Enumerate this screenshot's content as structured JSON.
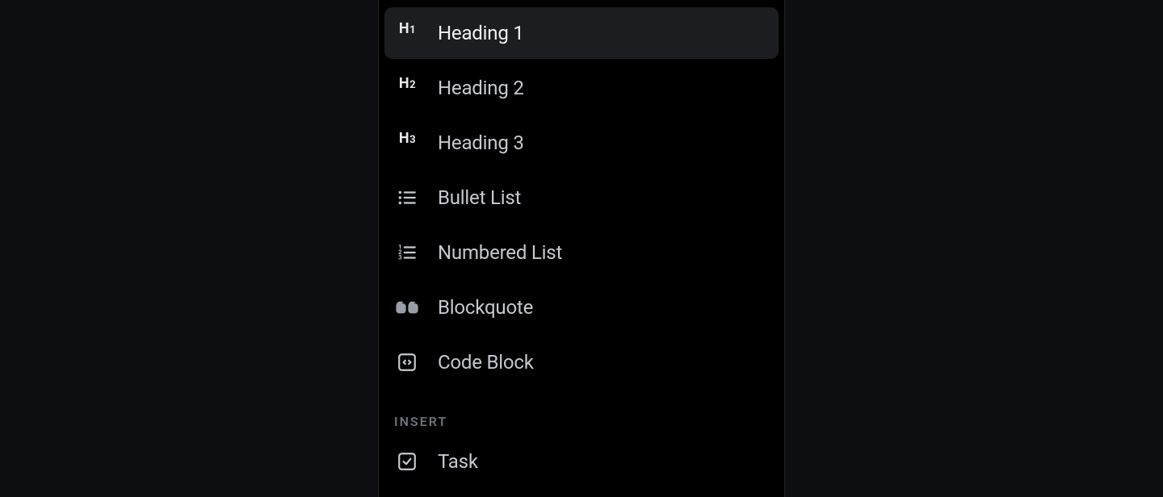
{
  "menu": {
    "format": [
      {
        "icon": "h1",
        "label": "Heading 1",
        "selected": true
      },
      {
        "icon": "h2",
        "label": "Heading 2",
        "selected": false
      },
      {
        "icon": "h3",
        "label": "Heading 3",
        "selected": false
      },
      {
        "icon": "bullet-list",
        "label": "Bullet List",
        "selected": false
      },
      {
        "icon": "numbered-list",
        "label": "Numbered List",
        "selected": false
      },
      {
        "icon": "blockquote",
        "label": "Blockquote",
        "selected": false
      },
      {
        "icon": "code-block",
        "label": "Code Block",
        "selected": false
      }
    ],
    "insert_header": "INSERT",
    "insert": [
      {
        "icon": "task",
        "label": "Task",
        "selected": false
      }
    ]
  }
}
